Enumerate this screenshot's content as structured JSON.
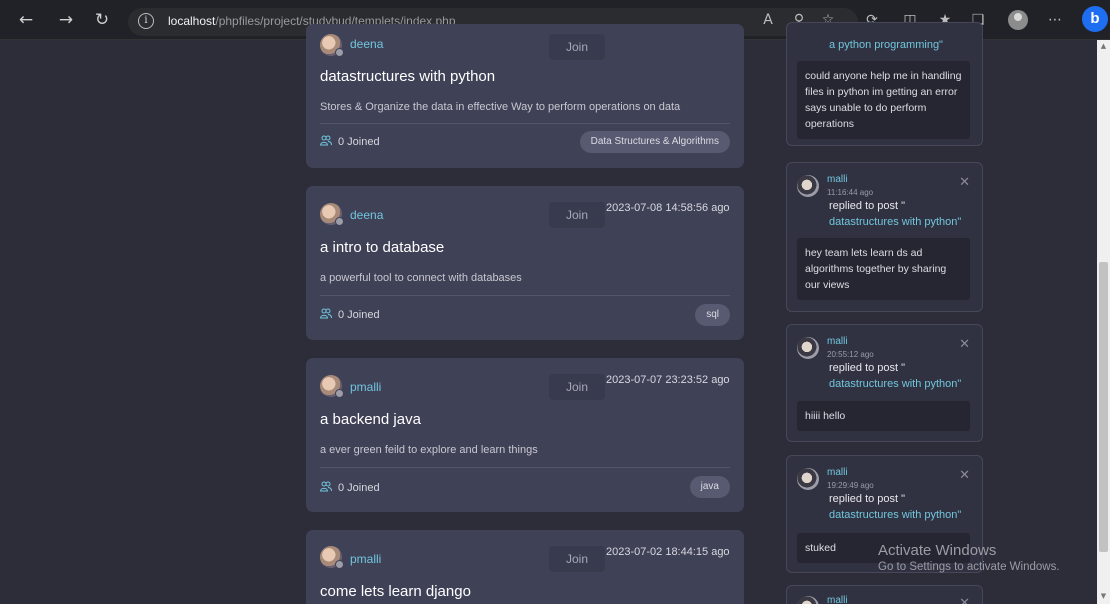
{
  "browser": {
    "url_host": "localhost",
    "url_path": "/phpfiles/project/studybud/templets/index.php",
    "bing_label": "b"
  },
  "feed": [
    {
      "user": "deena",
      "join_label": "Join",
      "date": "",
      "title": "datastructures with python",
      "description": "Stores & Organize the data in effective Way to perform operations on data",
      "joined": "0 Joined",
      "tag": "Data Structures & Algorithms"
    },
    {
      "user": "deena",
      "join_label": "Join",
      "date": "2023-07-08 14:58:56 ago",
      "title": "a intro to database",
      "description": "a powerful tool to connect with databases",
      "joined": "0 Joined",
      "tag": "sql"
    },
    {
      "user": "pmalli",
      "join_label": "Join",
      "date": "2023-07-07 23:23:52 ago",
      "title": "a backend java",
      "description": "a ever green feild to explore and learn things",
      "joined": "0 Joined",
      "tag": "java"
    },
    {
      "user": "pmalli",
      "join_label": "Join",
      "date": "2023-07-02 18:44:15 ago",
      "title": "come lets learn django"
    }
  ],
  "activity": [
    {
      "post": "a python programming\"",
      "message": "could anyone help me in handling files in python im getting an error says unable to do perform operations"
    },
    {
      "name": "malli",
      "time": "11:16:44 ago",
      "reply": "replied to post \"",
      "post": "datastructures with python\"",
      "message": "hey team lets learn ds ad algorithms together by sharing our views"
    },
    {
      "name": "malli",
      "time": "20:55:12 ago",
      "reply": "replied to post \"",
      "post": "datastructures with python\"",
      "message": "hiiii hello"
    },
    {
      "name": "malli",
      "time": "19:29:49 ago",
      "reply": "replied to post \"",
      "post": "datastructures with python\"",
      "message": "stuked"
    },
    {
      "name": "malli"
    }
  ],
  "watermark": {
    "line1": "Activate Windows",
    "line2": "Go to Settings to activate Windows."
  }
}
